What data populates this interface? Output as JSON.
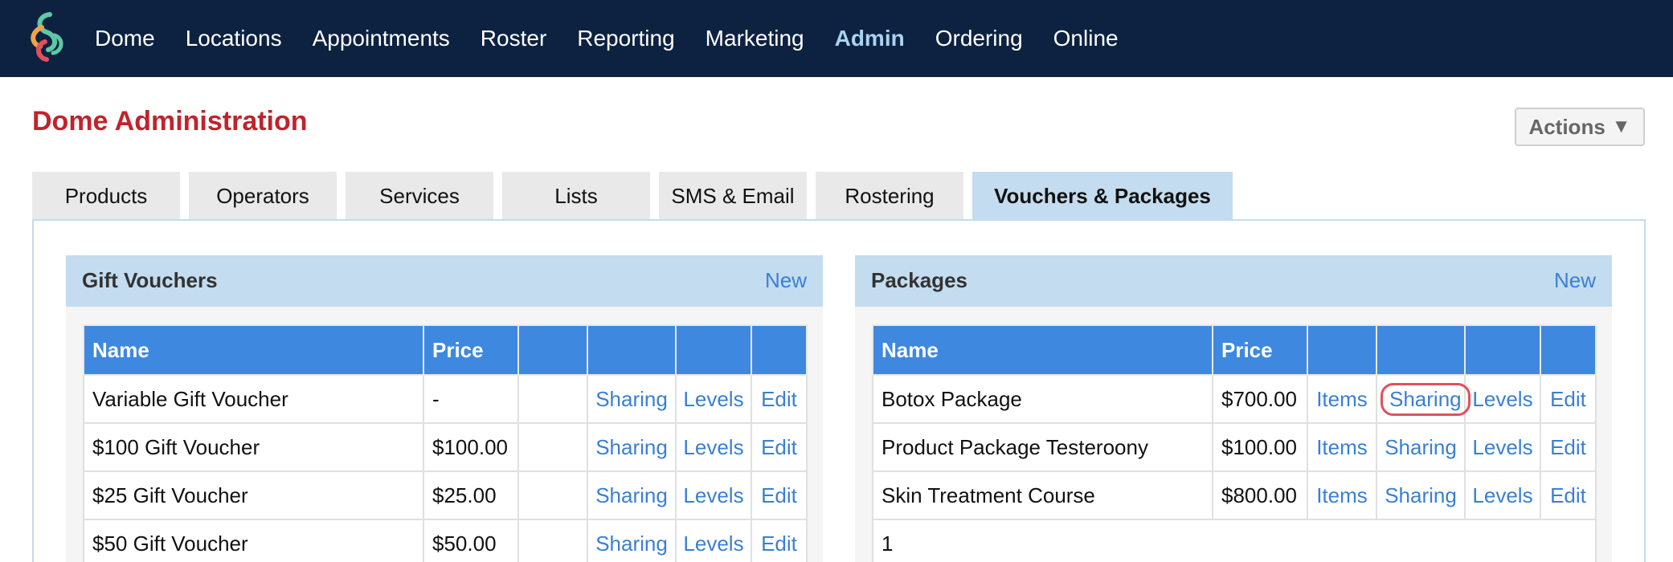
{
  "nav": {
    "items": [
      "Dome",
      "Locations",
      "Appointments",
      "Roster",
      "Reporting",
      "Marketing",
      "Admin",
      "Ordering",
      "Online"
    ],
    "active": "Admin"
  },
  "page": {
    "title": "Dome Administration",
    "actions_label": "Actions",
    "actions_caret": "▼"
  },
  "tabs": {
    "items": [
      "Products",
      "Operators",
      "Services",
      "Lists",
      "SMS & Email",
      "Rostering",
      "Vouchers & Packages"
    ],
    "active": "Vouchers & Packages"
  },
  "gift_vouchers": {
    "title": "Gift Vouchers",
    "new_label": "New",
    "columns": [
      "Name",
      "Price",
      "",
      "",
      "",
      ""
    ],
    "rows": [
      {
        "name": "Variable Gift Voucher",
        "price": "-",
        "sharing": "Sharing",
        "levels": "Levels",
        "edit": "Edit"
      },
      {
        "name": "$100 Gift Voucher",
        "price": "$100.00",
        "sharing": "Sharing",
        "levels": "Levels",
        "edit": "Edit"
      },
      {
        "name": "$25 Gift Voucher",
        "price": "$25.00",
        "sharing": "Sharing",
        "levels": "Levels",
        "edit": "Edit"
      },
      {
        "name": "$50 Gift Voucher",
        "price": "$50.00",
        "sharing": "Sharing",
        "levels": "Levels",
        "edit": "Edit"
      }
    ]
  },
  "packages": {
    "title": "Packages",
    "new_label": "New",
    "columns": [
      "Name",
      "Price",
      "",
      "",
      "",
      ""
    ],
    "rows": [
      {
        "name": "Botox Package",
        "price": "$700.00",
        "items": "Items",
        "sharing": "Sharing",
        "levels": "Levels",
        "edit": "Edit"
      },
      {
        "name": "Product Package Testeroony",
        "price": "$100.00",
        "items": "Items",
        "sharing": "Sharing",
        "levels": "Levels",
        "edit": "Edit"
      },
      {
        "name": "Skin Treatment Course",
        "price": "$800.00",
        "items": "Items",
        "sharing": "Sharing",
        "levels": "Levels",
        "edit": "Edit"
      }
    ],
    "pager": "1"
  },
  "colors": {
    "nav_bg": "#0d2240",
    "nav_active": "#a9d3f2",
    "title_red": "#c0232c",
    "panel_head": "#c3dcef",
    "table_head": "#3e88e0",
    "link": "#3a7fd5",
    "highlight": "#e0505d"
  }
}
